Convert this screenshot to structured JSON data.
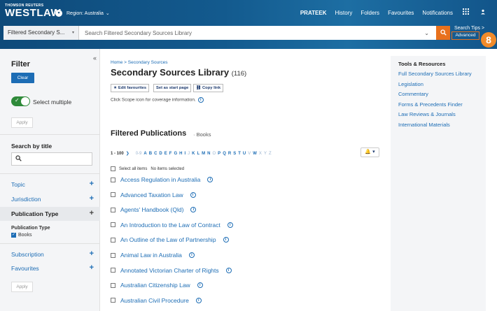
{
  "header": {
    "brand_small": "THOMSON REUTERS",
    "brand": "WESTLAW",
    "region": "Region: Australia",
    "nav": [
      "PRATEEK",
      "History",
      "Folders",
      "Favourites",
      "Notifications"
    ],
    "search_scope": "Filtered Secondary S...",
    "search_placeholder": "Search Filtered Secondary Sources Library",
    "search_tips": "Search Tips",
    "advanced": "Advanced",
    "badge": "8"
  },
  "sidebar": {
    "title": "Filter",
    "clear": "Clear",
    "select_multiple": "Select multiple",
    "apply": "Apply",
    "search_by_title": "Search by title",
    "facets": [
      "Topic",
      "Jurisdiction",
      "Publication Type",
      "Subscription",
      "Favourites"
    ],
    "publication_type_label": "Publication Type",
    "publication_type_value": "Books"
  },
  "main": {
    "breadcrumb": "Home > Secondary Sources",
    "title": "Secondary Sources Library",
    "count": "(116)",
    "chips": [
      "Edit favourites",
      "Set as start page",
      "Copy link"
    ],
    "scope_note": "Click Scope icon for coverage information.",
    "filtered_title": "Filtered Publications",
    "filtered_sub": "Books",
    "range": "1 - 100",
    "letters": [
      {
        "l": "0-9",
        "on": false
      },
      {
        "l": "A",
        "on": true
      },
      {
        "l": "B",
        "on": true
      },
      {
        "l": "C",
        "on": true
      },
      {
        "l": "D",
        "on": true
      },
      {
        "l": "E",
        "on": true
      },
      {
        "l": "F",
        "on": true
      },
      {
        "l": "G",
        "on": true
      },
      {
        "l": "H",
        "on": true
      },
      {
        "l": "I",
        "on": true
      },
      {
        "l": "J",
        "on": false
      },
      {
        "l": "K",
        "on": true
      },
      {
        "l": "L",
        "on": true
      },
      {
        "l": "M",
        "on": true
      },
      {
        "l": "N",
        "on": true
      },
      {
        "l": "O",
        "on": false
      },
      {
        "l": "P",
        "on": true
      },
      {
        "l": "Q",
        "on": true
      },
      {
        "l": "R",
        "on": true
      },
      {
        "l": "S",
        "on": true
      },
      {
        "l": "T",
        "on": true
      },
      {
        "l": "U",
        "on": true
      },
      {
        "l": "V",
        "on": false
      },
      {
        "l": "W",
        "on": true
      },
      {
        "l": "X",
        "on": false
      },
      {
        "l": "Y",
        "on": false
      },
      {
        "l": "Z",
        "on": false
      }
    ],
    "select_all": "Select all items",
    "no_items": "No items selected",
    "items": [
      "Access Regulation in Australia",
      "Advanced Taxation Law",
      "Agents' Handbook (Qld)",
      "An Introduction to the Law of Contract",
      "An Outline of the Law of Partnership",
      "Animal Law in Australia",
      "Annotated Victorian Charter of Rights",
      "Australian Citizenship Law",
      "Australian Civil Procedure"
    ]
  },
  "tools": {
    "title": "Tools & Resources",
    "links": [
      "Full Secondary Sources Library",
      "Legislation",
      "Commentary",
      "Forms & Precedents Finder",
      "Law Reviews & Journals",
      "International Materials"
    ]
  }
}
